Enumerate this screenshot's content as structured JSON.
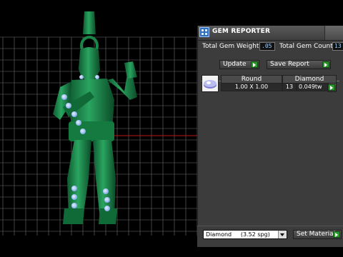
{
  "panel": {
    "title": "GEM REPORTER",
    "total_gem_weight_label": "Total Gem Weight",
    "total_gem_weight_value": ".05",
    "total_gem_count_label": "Total Gem Count",
    "total_gem_count_value": "13",
    "update_label": "Update",
    "save_report_label": "Save Report"
  },
  "gem_table": {
    "headers": [
      "Round",
      "Diamond"
    ],
    "row": {
      "size": "1.00 X 1.00",
      "count": "13",
      "weight": "0.049tw"
    }
  },
  "material": {
    "selected": "Diamond     (3.52 spg)",
    "set_label": "Set Material"
  },
  "colors": {
    "model_green": "#1f8a4c",
    "gem_blue": "#a9c8ff",
    "grid_line": "#7a7a7a",
    "axis_red": "#c0161c",
    "panel_bg": "#3c3c3c",
    "play_green": "#2d9a2d"
  }
}
